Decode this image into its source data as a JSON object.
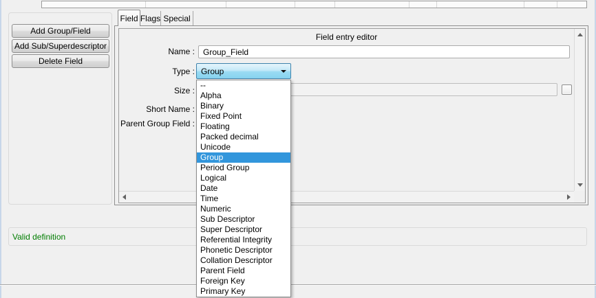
{
  "sidebar": {
    "buttons": [
      {
        "label": "Add Group/Field"
      },
      {
        "label": "Add Sub/Superdescriptor"
      },
      {
        "label": "Delete Field"
      }
    ]
  },
  "tabs": {
    "field": "Field",
    "flags": "Flags",
    "special": "Special",
    "active": "Field"
  },
  "editor": {
    "title": "Field entry editor",
    "name_label": "Name :",
    "name_value": "Group_Field",
    "type_label": "Type :",
    "type_value": "Group",
    "size_label": "Size :",
    "size_value": "",
    "size_checkbox_checked": false,
    "short_name_label": "Short Name :",
    "parent_group_field_label": "Parent Group Field :"
  },
  "type_dropdown": {
    "selected": "Group",
    "options": [
      "--",
      "Alpha",
      "Binary",
      "Fixed Point",
      "Floating",
      "Packed decimal",
      "Unicode",
      "Group",
      "Period Group",
      "Logical",
      "Date",
      "Time",
      "Numeric",
      "Sub Descriptor",
      "Super Descriptor",
      "Referential Integrity",
      "Phonetic Descriptor",
      "Collation Descriptor",
      "Parent Field",
      "Foreign Key",
      "Primary Key"
    ]
  },
  "status": {
    "message": "Valid definition"
  },
  "colors": {
    "selection_blue": "#3296dc",
    "status_green": "#007d00",
    "combo_border": "#3e82ab"
  }
}
